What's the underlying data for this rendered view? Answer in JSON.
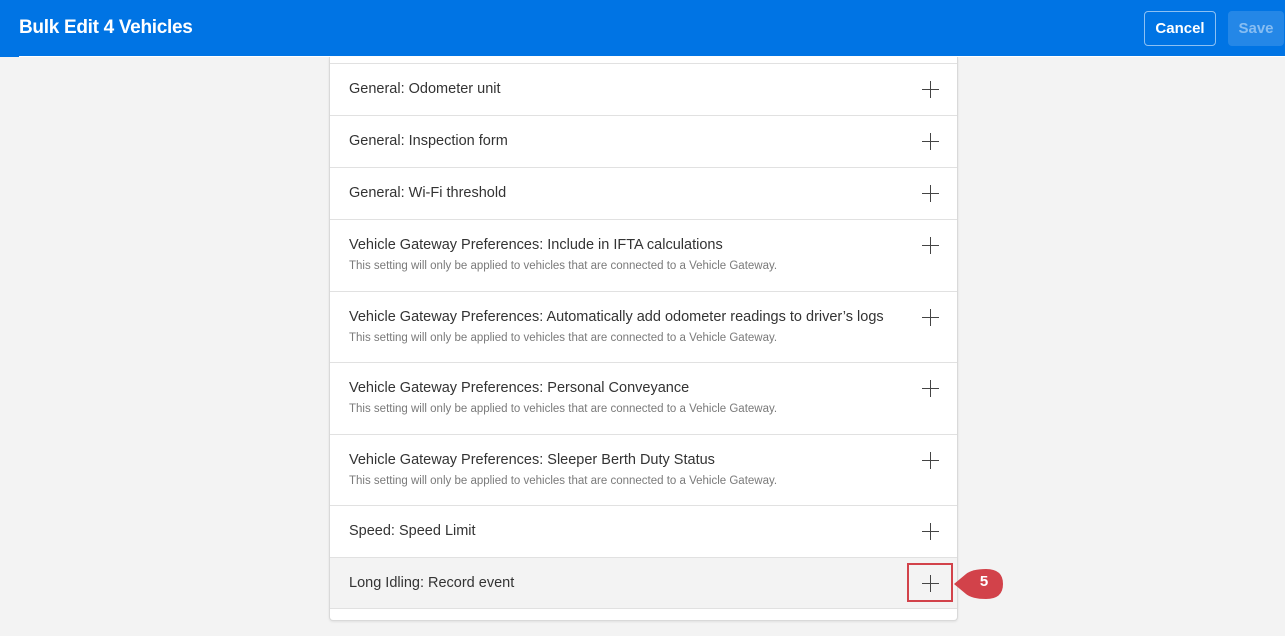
{
  "header": {
    "title": "Bulk Edit 4 Vehicles",
    "cancel_label": "Cancel",
    "save_label": "Save"
  },
  "settings": [
    {
      "label": "General: Odometer unit",
      "note": ""
    },
    {
      "label": "General: Inspection form",
      "note": ""
    },
    {
      "label": "General: Wi-Fi threshold",
      "note": ""
    },
    {
      "label": "Vehicle Gateway Preferences: Include in IFTA calculations",
      "note": "This setting will only be applied to vehicles that are connected to a Vehicle Gateway."
    },
    {
      "label": "Vehicle Gateway Preferences: Automatically add odometer readings to driver’s logs",
      "note": "This setting will only be applied to vehicles that are connected to a Vehicle Gateway."
    },
    {
      "label": "Vehicle Gateway Preferences: Personal Conveyance",
      "note": "This setting will only be applied to vehicles that are connected to a Vehicle Gateway."
    },
    {
      "label": "Vehicle Gateway Preferences: Sleeper Berth Duty Status",
      "note": "This setting will only be applied to vehicles that are connected to a Vehicle Gateway."
    },
    {
      "label": "Speed: Speed Limit",
      "note": ""
    },
    {
      "label": "Long Idling: Record event",
      "note": ""
    }
  ],
  "callout": {
    "number": "5",
    "color": "#d2424a"
  },
  "colors": {
    "header_bg": "#0074e4",
    "page_bg": "#f3f3f3"
  }
}
